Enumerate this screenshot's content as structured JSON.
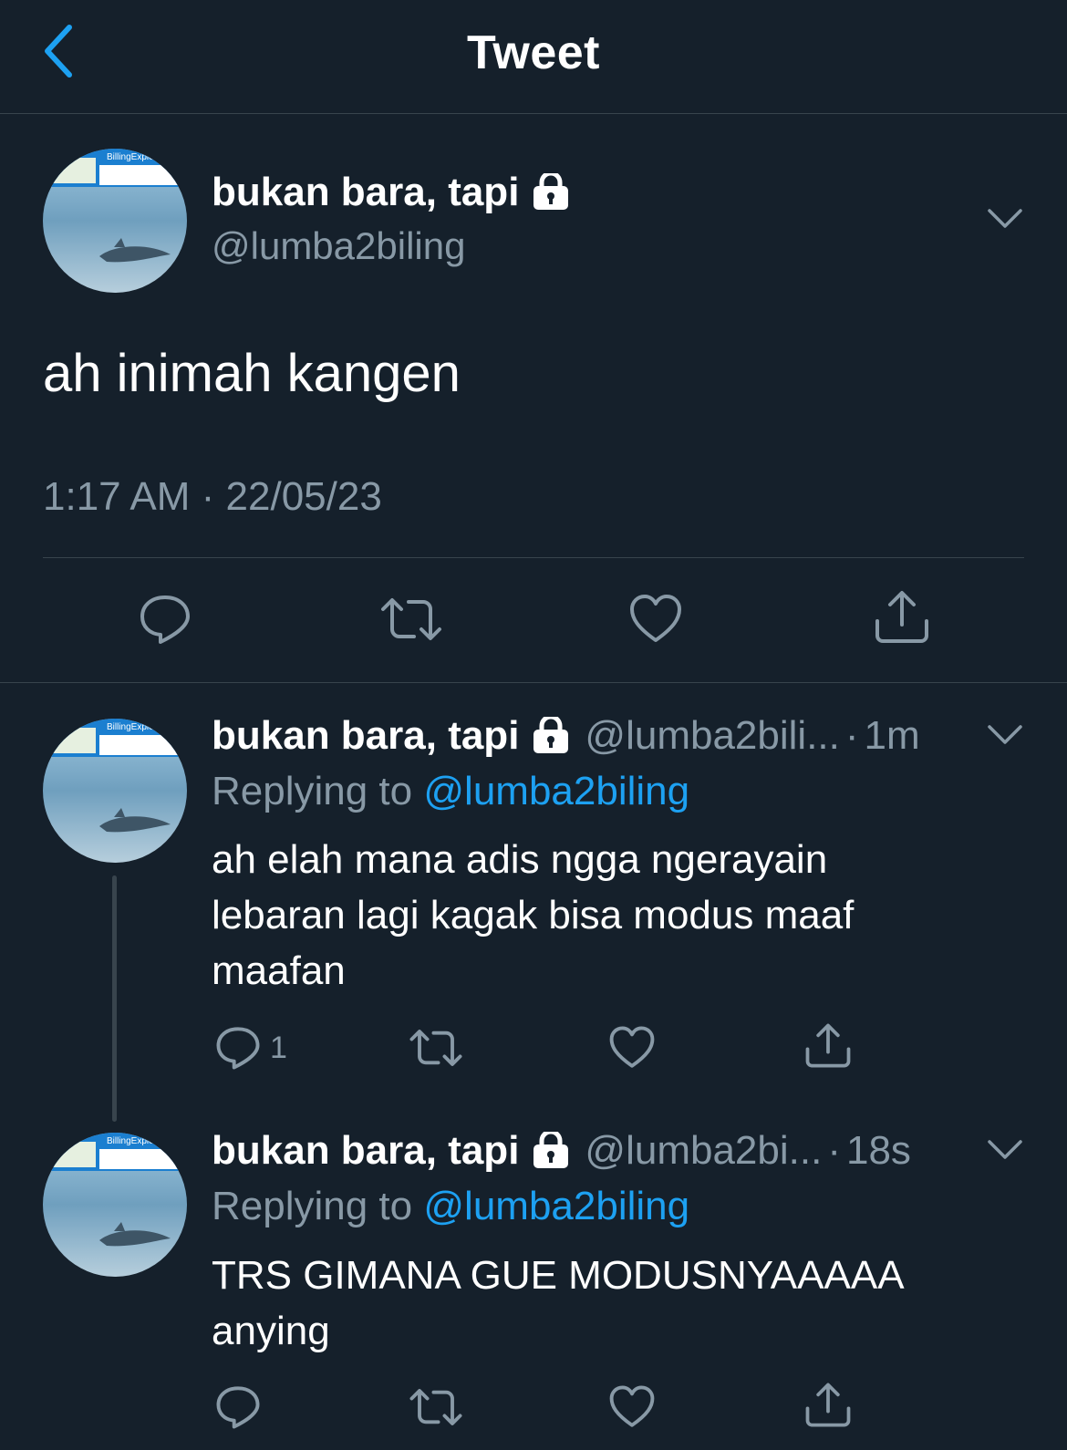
{
  "header": {
    "title": "Tweet"
  },
  "main_tweet": {
    "name": "bukan bara, tapi",
    "handle": "@lumba2biling",
    "text": "ah inimah kangen",
    "timestamp": "1:17 AM · 22/05/23"
  },
  "replies": [
    {
      "name": "bukan bara, tapi",
      "handle": "@lumba2bili...",
      "time": "1m",
      "replying_label": "Replying to",
      "replying_to": "@lumba2biling",
      "text": "ah elah mana adis ngga ngerayain\nlebaran lagi kagak bisa modus maaf\nmaafan",
      "reply_count": "1"
    },
    {
      "name": "bukan bara, tapi",
      "handle": "@lumba2bi...",
      "time": "18s",
      "replying_label": "Replying to",
      "replying_to": "@lumba2biling",
      "text": "TRS GIMANA GUE MODUSNYAAAAA\nanying",
      "reply_count": ""
    }
  ],
  "avatar_label": "BillingExplorer",
  "colors": {
    "background": "#15202b",
    "divider": "#38444d",
    "secondary_text": "#8899a6",
    "accent": "#1da1f2"
  },
  "icons": [
    "back-chevron-icon",
    "lock-icon",
    "chevron-down-icon",
    "reply-icon",
    "retweet-icon",
    "like-icon",
    "share-icon"
  ]
}
